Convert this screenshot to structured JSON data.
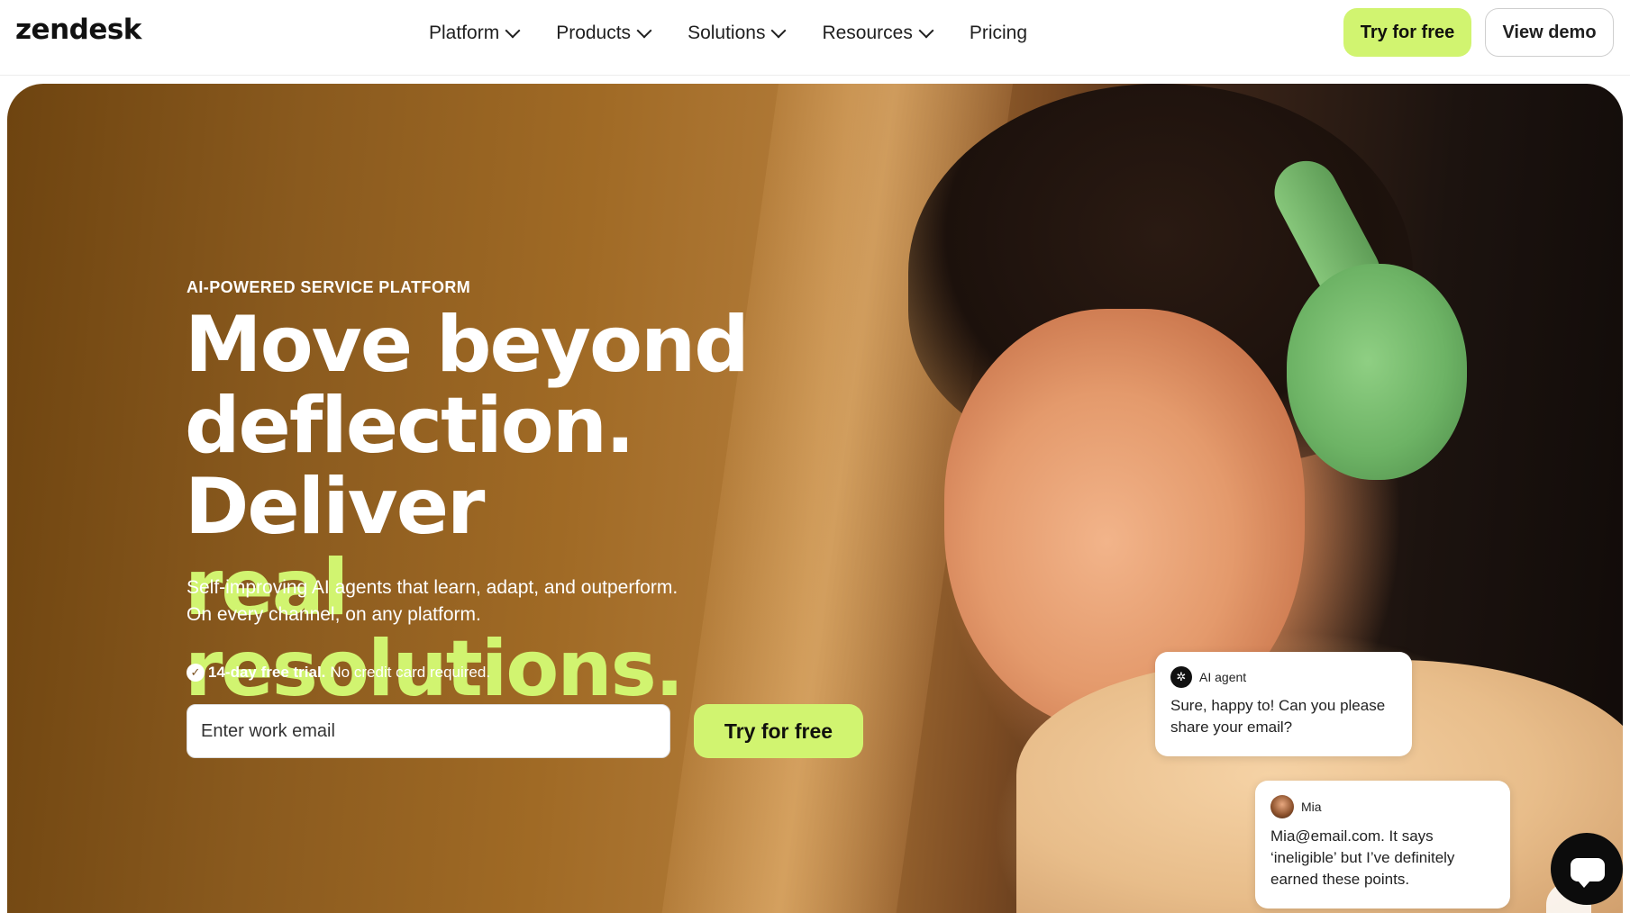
{
  "header": {
    "logo": "zendesk",
    "nav": [
      {
        "label": "Platform",
        "has_dropdown": true
      },
      {
        "label": "Products",
        "has_dropdown": true
      },
      {
        "label": "Solutions",
        "has_dropdown": true
      },
      {
        "label": "Resources",
        "has_dropdown": true
      },
      {
        "label": "Pricing",
        "has_dropdown": false
      }
    ],
    "try_label": "Try for free",
    "demo_label": "View demo"
  },
  "hero": {
    "eyebrow": "AI-POWERED SERVICE PLATFORM",
    "headline_line1": "Move beyond",
    "headline_line2": "deflection. Deliver",
    "headline_accent": "real resolutions.",
    "subtext_line1": "Self-improving AI agents that learn, adapt, and outperform.",
    "subtext_line2": "On every channel, on any platform.",
    "trial_bold": "14-day free trial.",
    "trial_rest": "No credit card required.",
    "email_placeholder": "Enter work email",
    "try_label": "Try for free"
  },
  "chat": {
    "ai_name": "AI agent",
    "ai_message": "Sure, happy to! Can you please share your email?",
    "user_name": "Mia",
    "user_message": "Mia@email.com. It says ‘ineligible’ but I’ve definitely earned these points."
  },
  "colors": {
    "accent": "#d1f470",
    "text_dark": "#1f1f1f",
    "fab": "#0c0c0c"
  },
  "icons": [
    "chevron-down-icon",
    "check-circle-icon",
    "ai-agent-icon",
    "chat-icon",
    "pause-icon"
  ]
}
